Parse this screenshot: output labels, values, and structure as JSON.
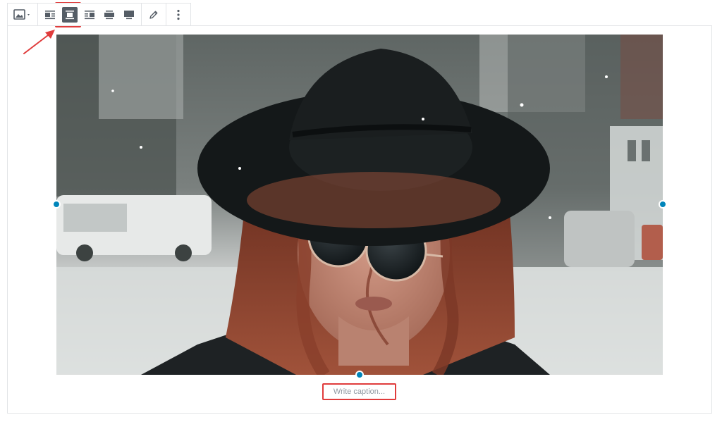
{
  "toolbar": {
    "items": [
      {
        "id": "block-type",
        "icon": "image-icon",
        "has_dropdown": true
      },
      {
        "id": "align-left",
        "icon": "align-left-icon"
      },
      {
        "id": "align-center",
        "icon": "align-center-icon",
        "active": true
      },
      {
        "id": "align-right",
        "icon": "align-right-icon"
      },
      {
        "id": "align-wide",
        "icon": "align-wide-icon"
      },
      {
        "id": "align-full",
        "icon": "align-full-icon"
      },
      {
        "id": "edit",
        "icon": "pencil-icon"
      },
      {
        "id": "more",
        "icon": "more-vertical-icon"
      }
    ],
    "active_color": "#555d66",
    "highlight_color": "#e03c3c"
  },
  "image": {
    "subject": "woman in black hat and round sunglasses, snowy street"
  },
  "caption": {
    "placeholder": "Write caption..."
  },
  "colors": {
    "handle": "#0085ba",
    "annotation": "#e03c3c",
    "border": "#e2e4e7"
  }
}
